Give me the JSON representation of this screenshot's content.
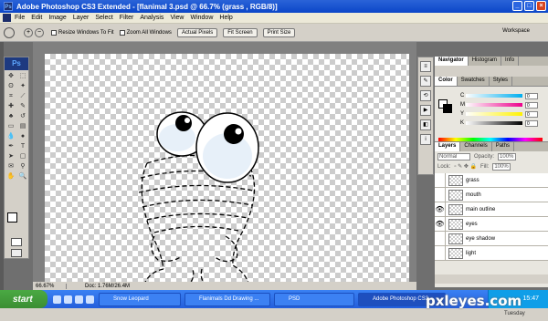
{
  "window": {
    "title": "Adobe Photoshop CS3 Extended - [flanimal 3.psd @ 66.7% (grass , RGB/8)]",
    "ps_icon": "Ps"
  },
  "menu": [
    "File",
    "Edit",
    "Image",
    "Layer",
    "Select",
    "Filter",
    "Analysis",
    "View",
    "Window",
    "Help"
  ],
  "options": {
    "resize": "Resize Windows To Fit",
    "zoom_all": "Zoom All Windows",
    "actual": "Actual Pixels",
    "fit": "Fit Screen",
    "print": "Print Size",
    "workspace": "Workspace"
  },
  "toolbox": {
    "logo": "Ps"
  },
  "status": {
    "zoom": "66.67%",
    "doc": "Doc: 1.76M/26.4M"
  },
  "right": {
    "nav_tabs": [
      "Navigator",
      "Histogram",
      "Info"
    ],
    "color_tabs": [
      "Color",
      "Swatches",
      "Styles"
    ],
    "color_rows": [
      {
        "label": "C",
        "value": "0"
      },
      {
        "label": "M",
        "value": "0"
      },
      {
        "label": "Y",
        "value": "0"
      },
      {
        "label": "K",
        "value": "0"
      }
    ],
    "layer_tabs": [
      "Layers",
      "Channels",
      "Paths"
    ],
    "blend": "Normal",
    "opacity_label": "Opacity:",
    "opacity": "100%",
    "lock_label": "Lock:",
    "fill_label": "Fill:",
    "fill": "100%",
    "layers": [
      {
        "name": "grass",
        "visible": false
      },
      {
        "name": "mouth",
        "visible": false
      },
      {
        "name": "main outline",
        "visible": true
      },
      {
        "name": "eyes",
        "visible": true
      },
      {
        "name": "eye shadow",
        "visible": false
      },
      {
        "name": "light",
        "visible": false
      }
    ]
  },
  "taskbar": {
    "start": "start",
    "tasks": [
      "Snow Leopard",
      "Flanimals Dd Drawing ...",
      "PSD",
      "Adobe Photoshop CS3 ..."
    ],
    "clock": "15:47"
  },
  "watermark": "pxleyes.com",
  "watermark_sub": "Tuesday"
}
